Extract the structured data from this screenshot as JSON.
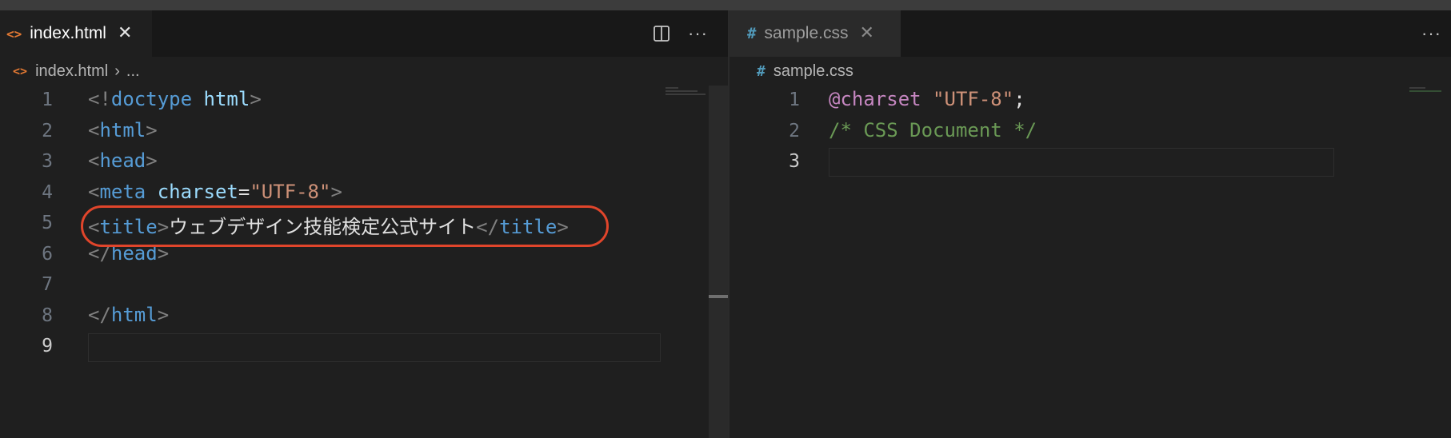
{
  "left_pane": {
    "tab": {
      "icon": "<>",
      "label": "index.html",
      "close": "✕"
    },
    "tools": {
      "split_icon": "split-editor-icon",
      "more": "···"
    },
    "breadcrumb": {
      "icon": "<>",
      "file": "index.html",
      "separator": "›",
      "rest": "..."
    },
    "lines": [
      {
        "num": "1",
        "tokens": [
          [
            "punct",
            "<!"
          ],
          [
            "tag",
            "doctype"
          ],
          [
            "txt",
            " "
          ],
          [
            "attr",
            "html"
          ],
          [
            "punct",
            ">"
          ]
        ]
      },
      {
        "num": "2",
        "tokens": [
          [
            "punct",
            "<"
          ],
          [
            "tag",
            "html"
          ],
          [
            "punct",
            ">"
          ]
        ]
      },
      {
        "num": "3",
        "tokens": [
          [
            "punct",
            "<"
          ],
          [
            "tag",
            "head"
          ],
          [
            "punct",
            ">"
          ]
        ]
      },
      {
        "num": "4",
        "tokens": [
          [
            "punct",
            "<"
          ],
          [
            "tag",
            "meta"
          ],
          [
            "txt",
            " "
          ],
          [
            "attr",
            "charset"
          ],
          [
            "txt",
            "="
          ],
          [
            "str",
            "\"UTF-8\""
          ],
          [
            "punct",
            ">"
          ]
        ]
      },
      {
        "num": "5",
        "tokens": [
          [
            "punct",
            "<"
          ],
          [
            "tag",
            "title"
          ],
          [
            "punct",
            ">"
          ],
          [
            "txt",
            "ウェブデザイン技能検定公式サイト"
          ],
          [
            "punct",
            "</"
          ],
          [
            "tag",
            "title"
          ],
          [
            "punct",
            ">"
          ]
        ]
      },
      {
        "num": "6",
        "tokens": [
          [
            "punct",
            "</"
          ],
          [
            "tag",
            "head"
          ],
          [
            "punct",
            ">"
          ]
        ]
      },
      {
        "num": "7",
        "tokens": []
      },
      {
        "num": "8",
        "tokens": [
          [
            "punct",
            "</"
          ],
          [
            "tag",
            "html"
          ],
          [
            "punct",
            ">"
          ]
        ]
      },
      {
        "num": "9",
        "tokens": []
      }
    ],
    "current_line": "9"
  },
  "right_pane": {
    "tab": {
      "icon": "#",
      "label": "sample.css",
      "close": "✕"
    },
    "tools": {
      "more": "···"
    },
    "breadcrumb": {
      "icon": "#",
      "file": "sample.css"
    },
    "lines": [
      {
        "num": "1",
        "tokens": [
          [
            "kw",
            "@charset"
          ],
          [
            "txt",
            " "
          ],
          [
            "str",
            "\"UTF-8\""
          ],
          [
            "txt",
            ";"
          ]
        ]
      },
      {
        "num": "2",
        "tokens": [
          [
            "cmt",
            "/* CSS Document */"
          ]
        ]
      },
      {
        "num": "3",
        "tokens": []
      }
    ],
    "current_line": "3"
  },
  "colors": {
    "html_icon": "#e37933",
    "css_icon": "#519aba",
    "annotation": "#e0452b"
  }
}
